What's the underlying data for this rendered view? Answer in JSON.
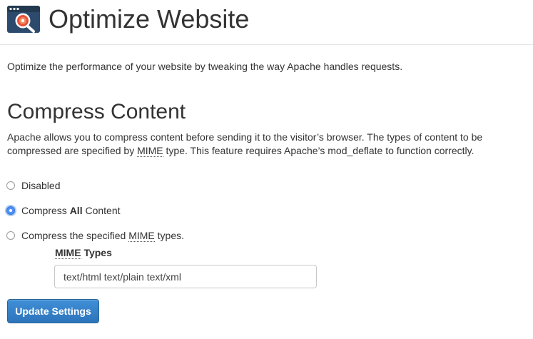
{
  "header": {
    "title": "Optimize Website",
    "icon": "optimize-website-icon"
  },
  "description": "Optimize the performance of your website by tweaking the way Apache handles requests.",
  "compress": {
    "heading": "Compress Content",
    "text_part1": "Apache allows you to compress content before sending it to the visitor’s browser. The types of content to be compressed are specified by ",
    "mime_abbr": "MIME",
    "text_part2": " type. This feature requires Apache’s mod_deflate to function correctly."
  },
  "options": {
    "disabled_label": "Disabled",
    "all_prefix": "Compress ",
    "all_bold": "All",
    "all_suffix": " Content",
    "specified_prefix": "Compress the specified ",
    "specified_abbr": "MIME",
    "specified_suffix": " types.",
    "selected": "all"
  },
  "mime_types": {
    "label_abbr": "MIME",
    "label_suffix": " Types",
    "value": "text/html text/plain text/xml"
  },
  "button": {
    "update_label": "Update Settings"
  },
  "colors": {
    "accent": "#4d90fe",
    "button": "#3a84c9",
    "text": "#333333"
  }
}
